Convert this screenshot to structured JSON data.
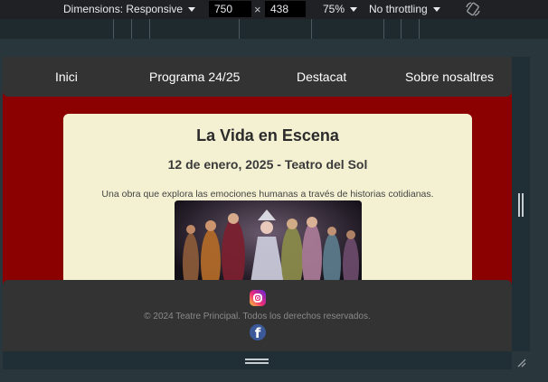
{
  "devtools": {
    "dimensions_label": "Dimensions: Responsive",
    "width_value": "750",
    "times_symbol": "×",
    "height_value": "438",
    "zoom": "75%",
    "throttling": "No throttling",
    "rotate_icon": "rotate-icon"
  },
  "site": {
    "nav": [
      "Inici",
      "Programa 24/25",
      "Destacat",
      "Sobre nosaltres"
    ],
    "event": {
      "title": "La Vida en Escena",
      "date": "12 de enero, 2025 - Teatro del Sol",
      "description": "Una obra que explora las emociones humanas a través de historias cotidianas."
    },
    "footer": {
      "copyright": "© 2024 Teatre Principal. Todos los derechos reservados.",
      "icons": [
        "instagram-icon",
        "facebook-icon"
      ]
    },
    "colors": {
      "page_background": "#8b0000",
      "nav_background": "#333333",
      "card_background": "#f4f1d2"
    }
  }
}
